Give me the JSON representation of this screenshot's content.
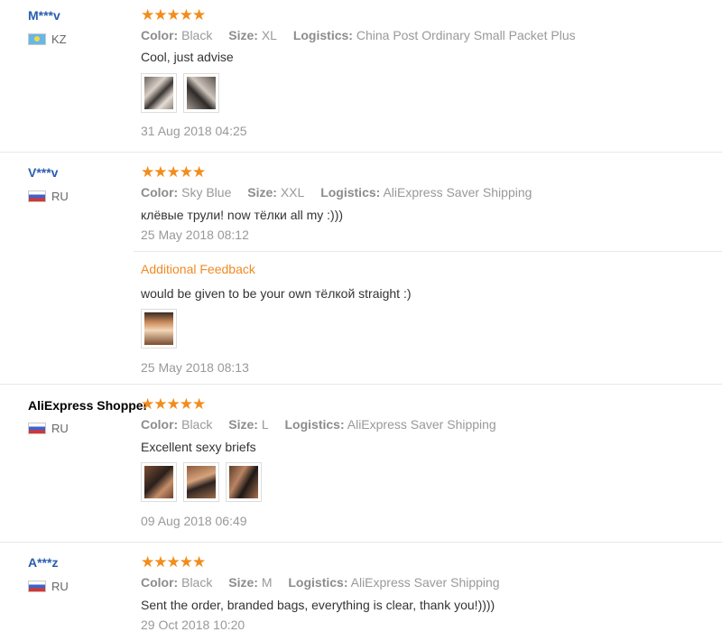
{
  "colors": {
    "star": "#f28c1b",
    "username": "#2a5db0",
    "additional_feedback": "#f08a24"
  },
  "reviews": [
    {
      "user": "M***v",
      "country": "KZ",
      "flag_icon": "kz-flag-icon",
      "stars": "★★★★★",
      "color_label": "Color:",
      "color": "Black",
      "size_label": "Size:",
      "size": "XL",
      "logistics_label": "Logistics:",
      "logistics": "China Post Ordinary Small Packet Plus",
      "text": "Cool, just advise",
      "photos": 2,
      "date": "31 Aug 2018 04:25"
    },
    {
      "user": "V***v",
      "country": "RU",
      "flag_icon": "ru-flag-icon",
      "stars": "★★★★★",
      "color_label": "Color:",
      "color": "Sky Blue",
      "size_label": "Size:",
      "size": "XXL",
      "logistics_label": "Logistics:",
      "logistics": "AliExpress Saver Shipping",
      "text": "клёвые трули! now тёлки all my :)))",
      "date": "25 May 2018 08:12",
      "additional": {
        "title": "Additional Feedback",
        "text": "would be given to be your own тёлкой straight :)",
        "photos": 1,
        "date": "25 May 2018 08:13"
      }
    },
    {
      "user": "AliExpress Shopper",
      "country": "RU",
      "flag_icon": "ru-flag-icon",
      "stars": "★★★★★",
      "color_label": "Color:",
      "color": "Black",
      "size_label": "Size:",
      "size": "L",
      "logistics_label": "Logistics:",
      "logistics": "AliExpress Saver Shipping",
      "text": "Excellent sexy briefs",
      "photos": 3,
      "date": "09 Aug 2018 06:49"
    },
    {
      "user": "A***z",
      "country": "RU",
      "flag_icon": "ru-flag-icon",
      "stars": "★★★★★",
      "color_label": "Color:",
      "color": "Black",
      "size_label": "Size:",
      "size": "M",
      "logistics_label": "Logistics:",
      "logistics": "AliExpress Saver Shipping",
      "text": "Sent the order, branded bags, everything is clear, thank you!))))",
      "date": "29 Oct 2018 10:20"
    }
  ]
}
